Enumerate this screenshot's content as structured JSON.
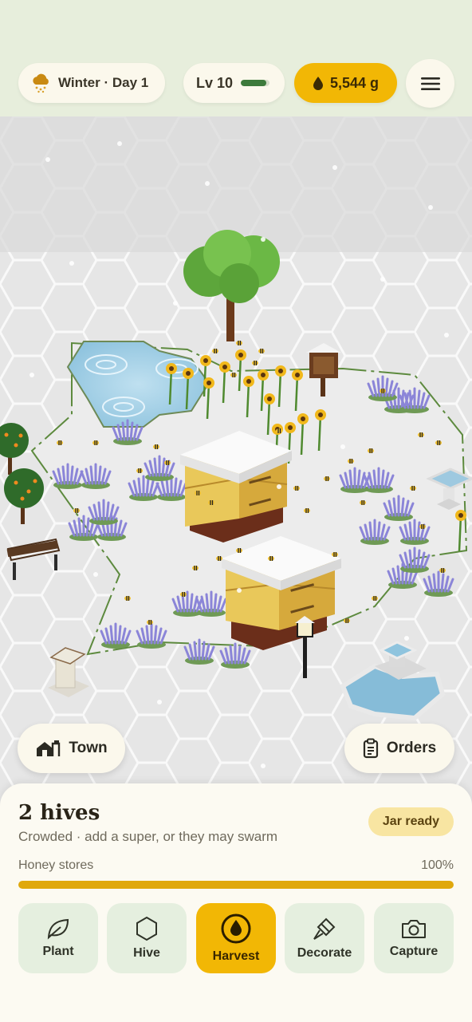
{
  "header": {
    "season_label": "Winter · Day 1",
    "season_icon": "snow-cloud-icon",
    "level_label": "Lv 10",
    "level_progress": 0.9,
    "honey_amount": "5,544 g",
    "honey_icon": "honey-drop-icon",
    "menu_icon": "hamburger-menu-icon"
  },
  "scene": {
    "town_button": "Town",
    "orders_button": "Orders"
  },
  "panel": {
    "title": "2 hives",
    "subtitle": "Crowded · add a super, or they may swarm",
    "badge": "Jar ready",
    "stores_label": "Honey stores",
    "stores_value": "100%",
    "stores_fraction": 1.0,
    "actions": [
      {
        "label": "Plant",
        "icon": "leaf-icon"
      },
      {
        "label": "Hive",
        "icon": "hexagon-icon"
      },
      {
        "label": "Harvest",
        "icon": "honey-drop-icon",
        "active": true
      },
      {
        "label": "Decorate",
        "icon": "paintbrush-icon"
      },
      {
        "label": "Capture",
        "icon": "camera-icon"
      }
    ]
  },
  "colors": {
    "accent": "#f2b705",
    "topbar_bg": "#e7eedc",
    "action_bg": "#e5efdf",
    "level_bar": "#3c7a3b",
    "stores_bar": "#e0a80c"
  }
}
